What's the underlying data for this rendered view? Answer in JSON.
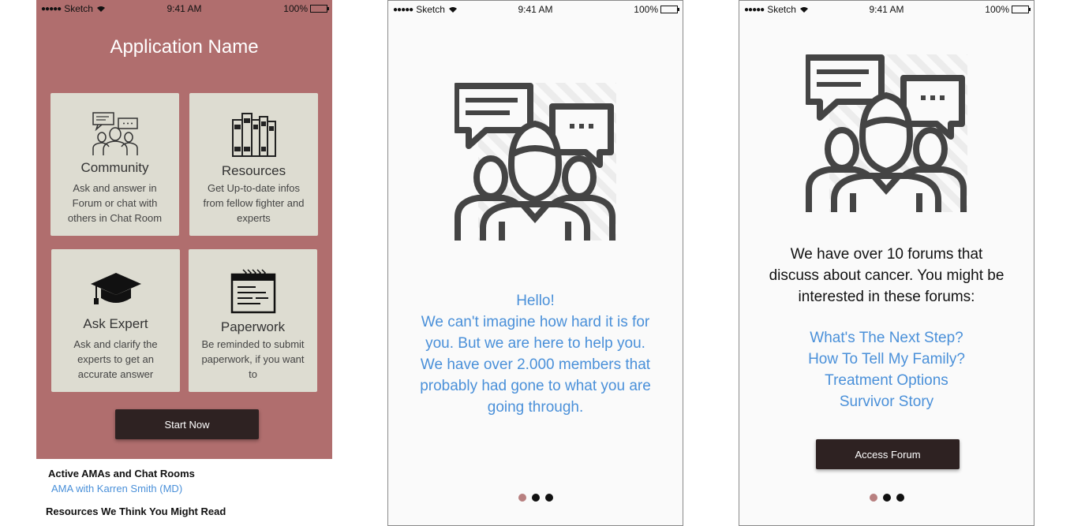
{
  "status_bar": {
    "carrier": "Sketch",
    "time": "9:41 AM",
    "battery": "100%"
  },
  "home": {
    "title": "Application Name",
    "cards": [
      {
        "icon": "community-icon",
        "title": "Community",
        "desc": "Ask and answer in Forum or chat with others in Chat Room"
      },
      {
        "icon": "books-icon",
        "title": "Resources",
        "desc": "Get Up-to-date infos from fellow fighter and experts"
      },
      {
        "icon": "graduation-cap-icon",
        "title": "Ask Expert",
        "desc": "Ask and clarify the experts to get an accurate answer"
      },
      {
        "icon": "calendar-icon",
        "title": "Paperwork",
        "desc": "Be reminded to submit paperwork, if you want to"
      }
    ],
    "start_button": "Start Now",
    "active_heading": "Active AMAs and Chat Rooms",
    "ama_link": "AMA with Karren Smith (MD)",
    "resources_heading": "Resources We Think You Might Read"
  },
  "onboard1": {
    "hello": "Hello!",
    "lines": [
      "We can't imagine how hard it is for",
      "you. But we are here to help you.",
      "We have over 2.000 members that",
      "probably had gone to what you are",
      "going through."
    ]
  },
  "onboard2": {
    "lines": [
      "We have over 10 forums that",
      "discuss about cancer. You might be",
      "interested in these forums:"
    ],
    "forums": [
      "What's The Next Step?",
      "How To Tell My Family?",
      "Treatment Options",
      "Survivor Story"
    ],
    "access_button": "Access Forum"
  },
  "colors": {
    "accent_rose": "#b06e6e",
    "card_bg": "#dddcd1",
    "button_dark": "#2e2222",
    "link_blue": "#4a90d9",
    "pager_active": "#b88080"
  }
}
